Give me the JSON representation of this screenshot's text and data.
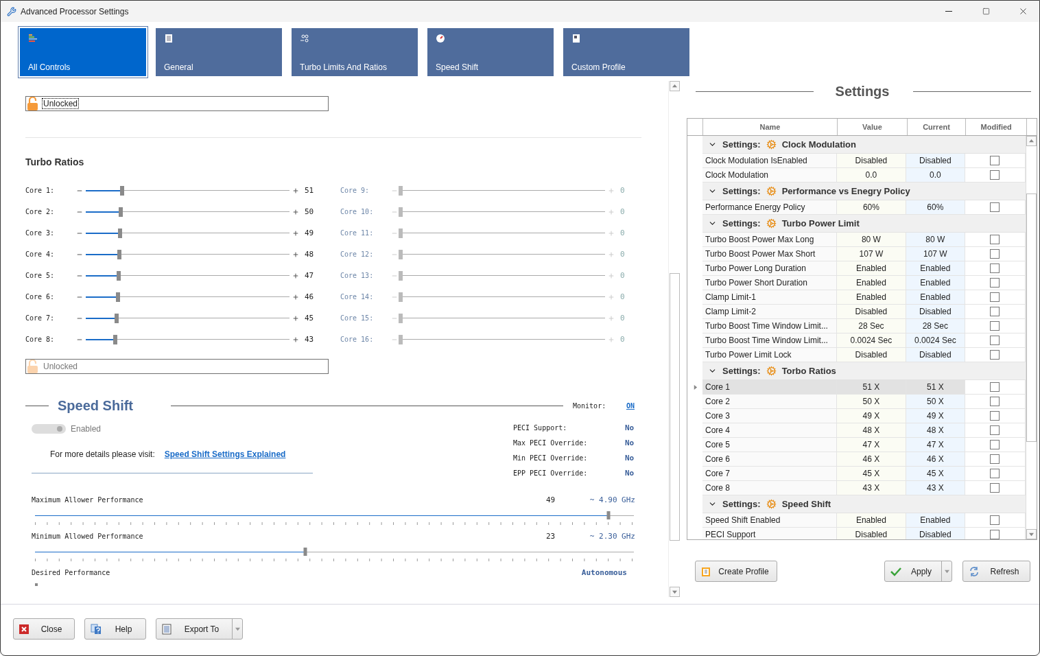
{
  "window": {
    "title": "Advanced Processor Settings"
  },
  "tabs": [
    {
      "label": "All Controls",
      "selected": true
    },
    {
      "label": "General",
      "selected": false
    },
    {
      "label": "Turbo Limits And Ratios",
      "selected": false
    },
    {
      "label": "Speed Shift",
      "selected": false
    },
    {
      "label": "Custom Profile",
      "selected": false
    }
  ],
  "lock_top": {
    "label": "Unlocked",
    "locked": false,
    "disabled": false
  },
  "turbo_ratios": {
    "title": "Turbo Ratios",
    "cores": [
      {
        "label": "Core 1:",
        "value": "51",
        "level": 0.18,
        "enabled": true
      },
      {
        "label": "Core 9:",
        "value": "0",
        "level": 0.0,
        "enabled": false
      },
      {
        "label": "Core 2:",
        "value": "50",
        "level": 0.172,
        "enabled": true
      },
      {
        "label": "Core 10:",
        "value": "0",
        "level": 0.0,
        "enabled": false
      },
      {
        "label": "Core 3:",
        "value": "49",
        "level": 0.168,
        "enabled": true
      },
      {
        "label": "Core 11:",
        "value": "0",
        "level": 0.0,
        "enabled": false
      },
      {
        "label": "Core 4:",
        "value": "48",
        "level": 0.165,
        "enabled": true
      },
      {
        "label": "Core 12:",
        "value": "0",
        "level": 0.0,
        "enabled": false
      },
      {
        "label": "Core 5:",
        "value": "47",
        "level": 0.16,
        "enabled": true
      },
      {
        "label": "Core 13:",
        "value": "0",
        "level": 0.0,
        "enabled": false
      },
      {
        "label": "Core 6:",
        "value": "46",
        "level": 0.158,
        "enabled": true
      },
      {
        "label": "Core 14:",
        "value": "0",
        "level": 0.0,
        "enabled": false
      },
      {
        "label": "Core 7:",
        "value": "45",
        "level": 0.152,
        "enabled": true
      },
      {
        "label": "Core 15:",
        "value": "0",
        "level": 0.0,
        "enabled": false
      },
      {
        "label": "Core 8:",
        "value": "43",
        "level": 0.145,
        "enabled": true
      },
      {
        "label": "Core 16:",
        "value": "0",
        "level": 0.0,
        "enabled": false
      }
    ]
  },
  "lock_bottom": {
    "label": "Unlocked",
    "locked": false,
    "disabled": true
  },
  "speed_shift": {
    "title": "Speed Shift",
    "monitor_label": "Monitor:",
    "monitor_link": "ON",
    "toggle": {
      "label": "Enabled",
      "on": true,
      "disabled": true
    },
    "details_text": "For more details please visit:",
    "details_link": "Speed Shift Settings Explained",
    "peci": [
      {
        "label": "PECI Support:",
        "value": "No"
      },
      {
        "label": "Max PECI Override:",
        "value": "No"
      },
      {
        "label": "Min PECI Override:",
        "value": "No"
      },
      {
        "label": "EPP PECI Override:",
        "value": "No"
      }
    ],
    "performance": [
      {
        "label": "Maximum Allower Performance",
        "value": "49",
        "frequency": "~ 4.90 GHz",
        "level": 0.958
      },
      {
        "label": "Minimum Allowed Performance",
        "value": "23",
        "frequency": "~ 2.30 GHz",
        "level": 0.451
      }
    ],
    "desired": {
      "label": "Desired Performance",
      "value": "Autonomous"
    }
  },
  "settings": {
    "title": "Settings",
    "columns": [
      "Name",
      "Value",
      "Current",
      "Modified"
    ],
    "groups": [
      {
        "prefix": "Settings:",
        "title": "Clock Modulation",
        "expanded": true,
        "rows": [
          {
            "name": "Clock Modulation IsEnabled",
            "value": "Disabled",
            "current": "Disabled",
            "modified": false,
            "selected": false
          },
          {
            "name": "Clock Modulation",
            "value": "0.0",
            "current": "0.0",
            "modified": false,
            "selected": false
          }
        ]
      },
      {
        "prefix": "Settings:",
        "title": "Performance vs Enegry Policy",
        "expanded": true,
        "rows": [
          {
            "name": "Performance Energy Policy",
            "value": "60%",
            "current": "60%",
            "modified": false,
            "selected": false
          }
        ]
      },
      {
        "prefix": "Settings:",
        "title": "Turbo Power Limit",
        "expanded": true,
        "rows": [
          {
            "name": "Turbo Boost Power Max Long",
            "value": "80 W",
            "current": "80 W",
            "modified": false,
            "selected": false
          },
          {
            "name": "Turbo Boost Power Max Short",
            "value": "107 W",
            "current": "107 W",
            "modified": false,
            "selected": false
          },
          {
            "name": "Turbo Power Long Duration",
            "value": "Enabled",
            "current": "Enabled",
            "modified": false,
            "selected": false
          },
          {
            "name": "Turbo Power Short Duration",
            "value": "Enabled",
            "current": "Enabled",
            "modified": false,
            "selected": false
          },
          {
            "name": "Clamp Limit-1",
            "value": "Enabled",
            "current": "Enabled",
            "modified": false,
            "selected": false
          },
          {
            "name": "Clamp Limit-2",
            "value": "Disabled",
            "current": "Disabled",
            "modified": false,
            "selected": false
          },
          {
            "name": "Turbo Boost Time Window Limit...",
            "value": "28 Sec",
            "current": "28 Sec",
            "modified": false,
            "selected": false
          },
          {
            "name": "Turbo Boost Time Window Limit...",
            "value": "0.0024 Sec",
            "current": "0.0024 Sec",
            "modified": false,
            "selected": false
          },
          {
            "name": "Turbo Power Limit Lock",
            "value": "Disabled",
            "current": "Disabled",
            "modified": false,
            "selected": false
          }
        ]
      },
      {
        "prefix": "Settings:",
        "title": "Torbo Ratios",
        "expanded": true,
        "rows": [
          {
            "name": "Core 1",
            "value": "51 X",
            "current": "51 X",
            "modified": false,
            "selected": true
          },
          {
            "name": "Core 2",
            "value": "50 X",
            "current": "50 X",
            "modified": false,
            "selected": false
          },
          {
            "name": "Core 3",
            "value": "49 X",
            "current": "49 X",
            "modified": false,
            "selected": false
          },
          {
            "name": "Core 4",
            "value": "48 X",
            "current": "48 X",
            "modified": false,
            "selected": false
          },
          {
            "name": "Core 5",
            "value": "47 X",
            "current": "47 X",
            "modified": false,
            "selected": false
          },
          {
            "name": "Core 6",
            "value": "46 X",
            "current": "46 X",
            "modified": false,
            "selected": false
          },
          {
            "name": "Core 7",
            "value": "45 X",
            "current": "45 X",
            "modified": false,
            "selected": false
          },
          {
            "name": "Core 8",
            "value": "43 X",
            "current": "43 X",
            "modified": false,
            "selected": false
          }
        ]
      },
      {
        "prefix": "Settings:",
        "title": "Speed Shift",
        "expanded": true,
        "rows": [
          {
            "name": "Speed Shift Enabled",
            "value": "Enabled",
            "current": "Enabled",
            "modified": false,
            "selected": false
          },
          {
            "name": "PECI Support",
            "value": "Disabled",
            "current": "Disabled",
            "modified": false,
            "selected": false
          }
        ]
      }
    ],
    "buttons": [
      {
        "label": "Create Profile",
        "dropdown": false
      },
      {
        "label": "Apply",
        "dropdown": true
      },
      {
        "label": "Refresh",
        "dropdown": false
      }
    ]
  },
  "footer_buttons": [
    {
      "label": "Close",
      "dropdown": false
    },
    {
      "label": "Help",
      "dropdown": false
    },
    {
      "label": "Export To",
      "dropdown": true
    }
  ]
}
